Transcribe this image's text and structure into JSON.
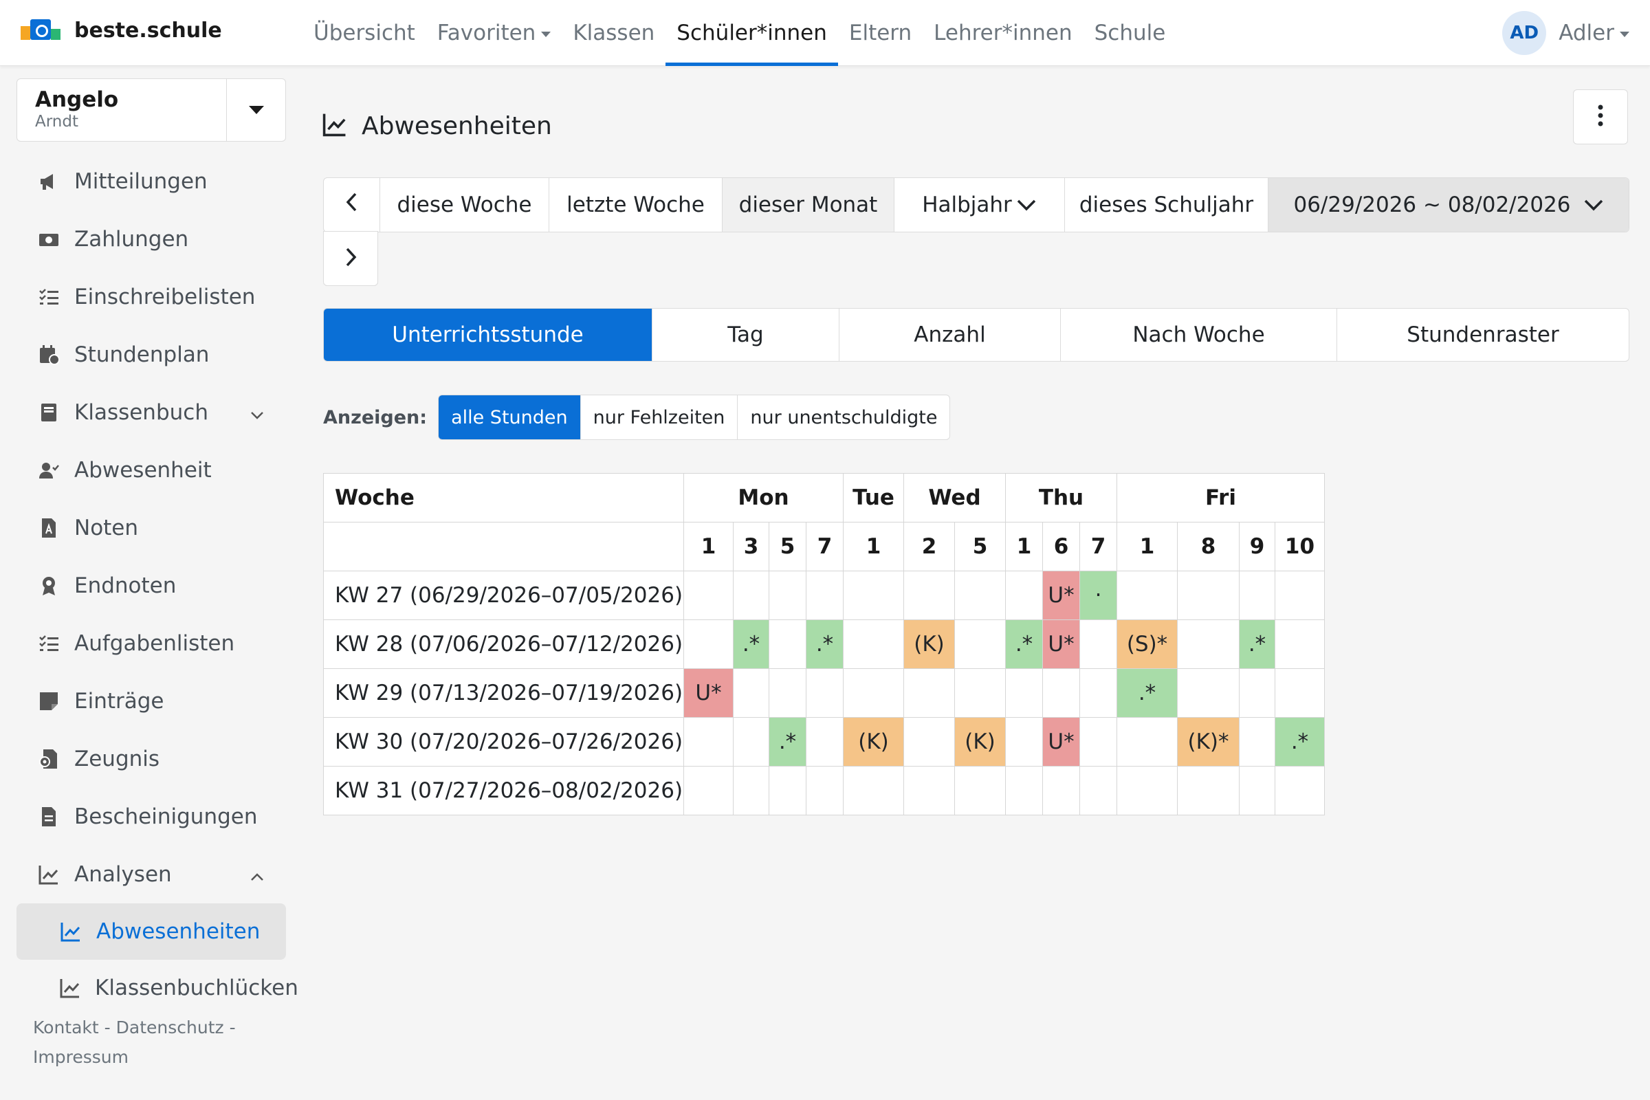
{
  "brand": {
    "name": "beste.schule"
  },
  "topnav": {
    "items": [
      {
        "label": "Übersicht"
      },
      {
        "label": "Favoriten"
      },
      {
        "label": "Klassen"
      },
      {
        "label": "Schüler*innen"
      },
      {
        "label": "Eltern"
      },
      {
        "label": "Lehrer*innen"
      },
      {
        "label": "Schule"
      }
    ],
    "active_index": 3
  },
  "user": {
    "initials": "AD",
    "name": "Adler"
  },
  "student": {
    "first": "Angelo",
    "last": "Arndt"
  },
  "sidebar": {
    "items": [
      {
        "label": "Mitteilungen",
        "icon": "megaphone-icon"
      },
      {
        "label": "Zahlungen",
        "icon": "money-icon"
      },
      {
        "label": "Einschreibelisten",
        "icon": "checklist-icon"
      },
      {
        "label": "Stundenplan",
        "icon": "calendar-clock-icon"
      },
      {
        "label": "Klassenbuch",
        "icon": "book-icon"
      },
      {
        "label": "Abwesenheit",
        "icon": "user-check-icon"
      },
      {
        "label": "Noten",
        "icon": "file-grade-icon"
      },
      {
        "label": "Endnoten",
        "icon": "award-icon"
      },
      {
        "label": "Aufgabenlisten",
        "icon": "checklist-icon"
      },
      {
        "label": "Einträge",
        "icon": "note-icon"
      },
      {
        "label": "Zeugnis",
        "icon": "certificate-icon"
      },
      {
        "label": "Bescheinigungen",
        "icon": "document-icon"
      },
      {
        "label": "Analysen",
        "icon": "chart-line-icon"
      }
    ],
    "sub_items": [
      {
        "label": "Abwesenheiten",
        "icon": "chart-line-icon"
      },
      {
        "label": "Klassenbuchlücken",
        "icon": "chart-line-icon"
      }
    ],
    "footer": {
      "contact": "Kontakt",
      "privacy": "Datenschutz",
      "imprint": "Impressum",
      "separator": "-"
    }
  },
  "page": {
    "title": "Abwesenheiten"
  },
  "range": {
    "buttons": [
      "diese Woche",
      "letzte Woche",
      "dieser Monat",
      "Halbjahr",
      "dieses Schuljahr"
    ],
    "active_index": 2,
    "date_range": "06/29/2026 ~ 08/02/2026"
  },
  "modes": {
    "tabs": [
      "Unterrichtsstunde",
      "Tag",
      "Anzahl",
      "Nach Woche",
      "Stundenraster"
    ],
    "active_index": 0
  },
  "filter": {
    "label": "Anzeigen:",
    "options": [
      "alle Stunden",
      "nur Fehlzeiten",
      "nur unentschuldigte"
    ],
    "active_index": 0
  },
  "table": {
    "header_week": "Woche",
    "days": [
      {
        "name": "Mon",
        "periods": [
          "1",
          "3",
          "5",
          "7"
        ]
      },
      {
        "name": "Tue",
        "periods": [
          "1"
        ]
      },
      {
        "name": "Wed",
        "periods": [
          "2",
          "5"
        ]
      },
      {
        "name": "Thu",
        "periods": [
          "1",
          "6",
          "7"
        ]
      },
      {
        "name": "Fri",
        "periods": [
          "1",
          "8",
          "9",
          "10"
        ]
      }
    ],
    "rows": [
      {
        "week": "KW 27 (06/29/2026–07/05/2026)",
        "cells": [
          {
            "t": "",
            "c": ""
          },
          {
            "t": "",
            "c": ""
          },
          {
            "t": "",
            "c": ""
          },
          {
            "t": "",
            "c": ""
          },
          {
            "t": "",
            "c": ""
          },
          {
            "t": "",
            "c": ""
          },
          {
            "t": "",
            "c": ""
          },
          {
            "t": "",
            "c": ""
          },
          {
            "t": "U*",
            "c": "red"
          },
          {
            "t": "·",
            "c": "green"
          },
          {
            "t": "",
            "c": ""
          },
          {
            "t": "",
            "c": ""
          },
          {
            "t": "",
            "c": ""
          },
          {
            "t": "",
            "c": ""
          }
        ]
      },
      {
        "week": "KW 28 (07/06/2026–07/12/2026)",
        "cells": [
          {
            "t": "",
            "c": ""
          },
          {
            "t": ".*",
            "c": "green"
          },
          {
            "t": "",
            "c": ""
          },
          {
            "t": ".*",
            "c": "green"
          },
          {
            "t": "",
            "c": ""
          },
          {
            "t": "(K)",
            "c": "orange"
          },
          {
            "t": "",
            "c": ""
          },
          {
            "t": ".*",
            "c": "green"
          },
          {
            "t": "U*",
            "c": "red"
          },
          {
            "t": "",
            "c": ""
          },
          {
            "t": "(S)*",
            "c": "orange"
          },
          {
            "t": "",
            "c": ""
          },
          {
            "t": ".*",
            "c": "green"
          },
          {
            "t": "",
            "c": ""
          }
        ]
      },
      {
        "week": "KW 29 (07/13/2026–07/19/2026)",
        "cells": [
          {
            "t": "U*",
            "c": "red"
          },
          {
            "t": "",
            "c": ""
          },
          {
            "t": "",
            "c": ""
          },
          {
            "t": "",
            "c": ""
          },
          {
            "t": "",
            "c": ""
          },
          {
            "t": "",
            "c": ""
          },
          {
            "t": "",
            "c": ""
          },
          {
            "t": "",
            "c": ""
          },
          {
            "t": "",
            "c": ""
          },
          {
            "t": "",
            "c": ""
          },
          {
            "t": ".*",
            "c": "green"
          },
          {
            "t": "",
            "c": ""
          },
          {
            "t": "",
            "c": ""
          },
          {
            "t": "",
            "c": ""
          }
        ]
      },
      {
        "week": "KW 30 (07/20/2026–07/26/2026)",
        "cells": [
          {
            "t": "",
            "c": ""
          },
          {
            "t": "",
            "c": ""
          },
          {
            "t": ".*",
            "c": "green"
          },
          {
            "t": "",
            "c": ""
          },
          {
            "t": "(K)",
            "c": "orange"
          },
          {
            "t": "",
            "c": ""
          },
          {
            "t": "(K)",
            "c": "orange"
          },
          {
            "t": "",
            "c": ""
          },
          {
            "t": "U*",
            "c": "red"
          },
          {
            "t": "",
            "c": ""
          },
          {
            "t": "",
            "c": ""
          },
          {
            "t": "(K)*",
            "c": "orange"
          },
          {
            "t": "",
            "c": ""
          },
          {
            "t": ".*",
            "c": "green"
          }
        ]
      },
      {
        "week": "KW 31 (07/27/2026–08/02/2026)",
        "cells": [
          {
            "t": "",
            "c": ""
          },
          {
            "t": "",
            "c": ""
          },
          {
            "t": "",
            "c": ""
          },
          {
            "t": "",
            "c": ""
          },
          {
            "t": "",
            "c": ""
          },
          {
            "t": "",
            "c": ""
          },
          {
            "t": "",
            "c": ""
          },
          {
            "t": "",
            "c": ""
          },
          {
            "t": "",
            "c": ""
          },
          {
            "t": "",
            "c": ""
          },
          {
            "t": "",
            "c": ""
          },
          {
            "t": "",
            "c": ""
          },
          {
            "t": "",
            "c": ""
          },
          {
            "t": "",
            "c": ""
          }
        ]
      }
    ]
  },
  "colors": {
    "accent": "#0a6fd6",
    "absent_unexcused": "#ea9c9c",
    "present_note": "#a8dca8",
    "excused": "#f5c488"
  }
}
